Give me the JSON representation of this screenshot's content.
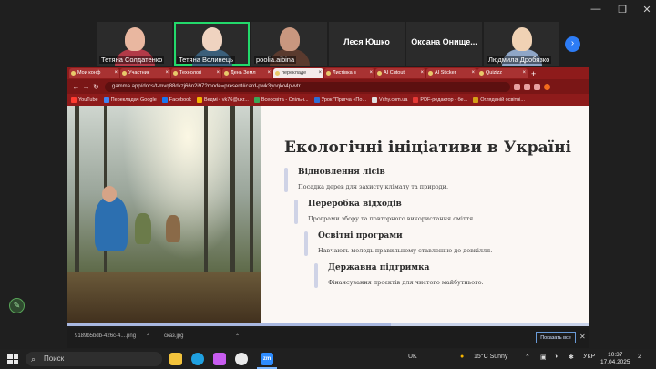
{
  "window_controls": {
    "minimize": "—",
    "maximize": "❐",
    "close": "✕"
  },
  "participants": [
    {
      "name": "Тетяна Солдатенко",
      "type": "video",
      "skin": "#e9b7a0",
      "cloth": "#b23a48"
    },
    {
      "name": "Тетяна Волинець",
      "type": "video",
      "active": true,
      "skin": "#efd3c0",
      "cloth": "#3b5f7a"
    },
    {
      "name": "poolia.aibina",
      "type": "video",
      "skin": "#c9977f",
      "cloth": "#5a3a2e"
    },
    {
      "name": "Леся Юшко",
      "type": "name",
      "display": "Леся Юшко"
    },
    {
      "name": "Оксана Онищенко",
      "type": "name",
      "display": "Оксана  Онище..."
    },
    {
      "name": "Людмила Дробязко",
      "type": "video",
      "skin": "#f0d2b4",
      "cloth": "#8fa6c7"
    }
  ],
  "next_button": "›",
  "browser": {
    "tabs": [
      "Мои конф",
      "Участник",
      "Технологі",
      "День Земл",
      "перекладе",
      "Листівка з",
      "AI Cutout",
      "AI Sticker",
      "Quizizz"
    ],
    "active_tab_index": 4,
    "new_tab": "+",
    "url": "gamma.app/docs/t-mvq88dkzj66n2i97?mode=present#card-pwk3yoqko4pvvtr",
    "bookmarks": [
      {
        "label": "YouTube",
        "color": "#ff3b30"
      },
      {
        "label": "Перекладач Google",
        "color": "#4285f4"
      },
      {
        "label": "Facebook",
        "color": "#1877f2"
      },
      {
        "label": "Ведмі • vk76@ukr...",
        "color": "#f4b400"
      },
      {
        "label": "Всеосвіта - Спільн...",
        "color": "#3aa757"
      },
      {
        "label": "Урок \"Пригча «По...",
        "color": "#2f6fd6"
      },
      {
        "label": "Vchy.com.ua",
        "color": "#e0e0e0"
      },
      {
        "label": "PDF-редактор - бе...",
        "color": "#e53935"
      },
      {
        "label": "Огляданій освітні...",
        "color": "#d4a017"
      }
    ]
  },
  "slide": {
    "title": "Екологічні ініціативи в Україні",
    "steps": [
      {
        "heading": "Відновлення лісів",
        "desc": "Посадка дерев для захисту клімату та природи."
      },
      {
        "heading": "Переробка відходів",
        "desc": "Програми збору та повторного використання сміття."
      },
      {
        "heading": "Освітні програми",
        "desc": "Навчають молодь правильному ставленню до довкілля."
      },
      {
        "heading": "Державна підтримка",
        "desc": "Фінансування проєктів для чистого майбутнього."
      }
    ],
    "progress_fraction": 0.62
  },
  "downloads": {
    "items": [
      "9189b5bdb-426c-4....png",
      "сказ.jpg"
    ],
    "show_all": "Показать все",
    "close": "✕"
  },
  "taskbar": {
    "search_placeholder": "Поиск",
    "keyboard_indicator": "UK",
    "weather": "15°C  Sunny",
    "language": "УКР",
    "time": "10:37",
    "date": "17.04.2025",
    "notification_count": "2",
    "zoom_label": "zm"
  }
}
